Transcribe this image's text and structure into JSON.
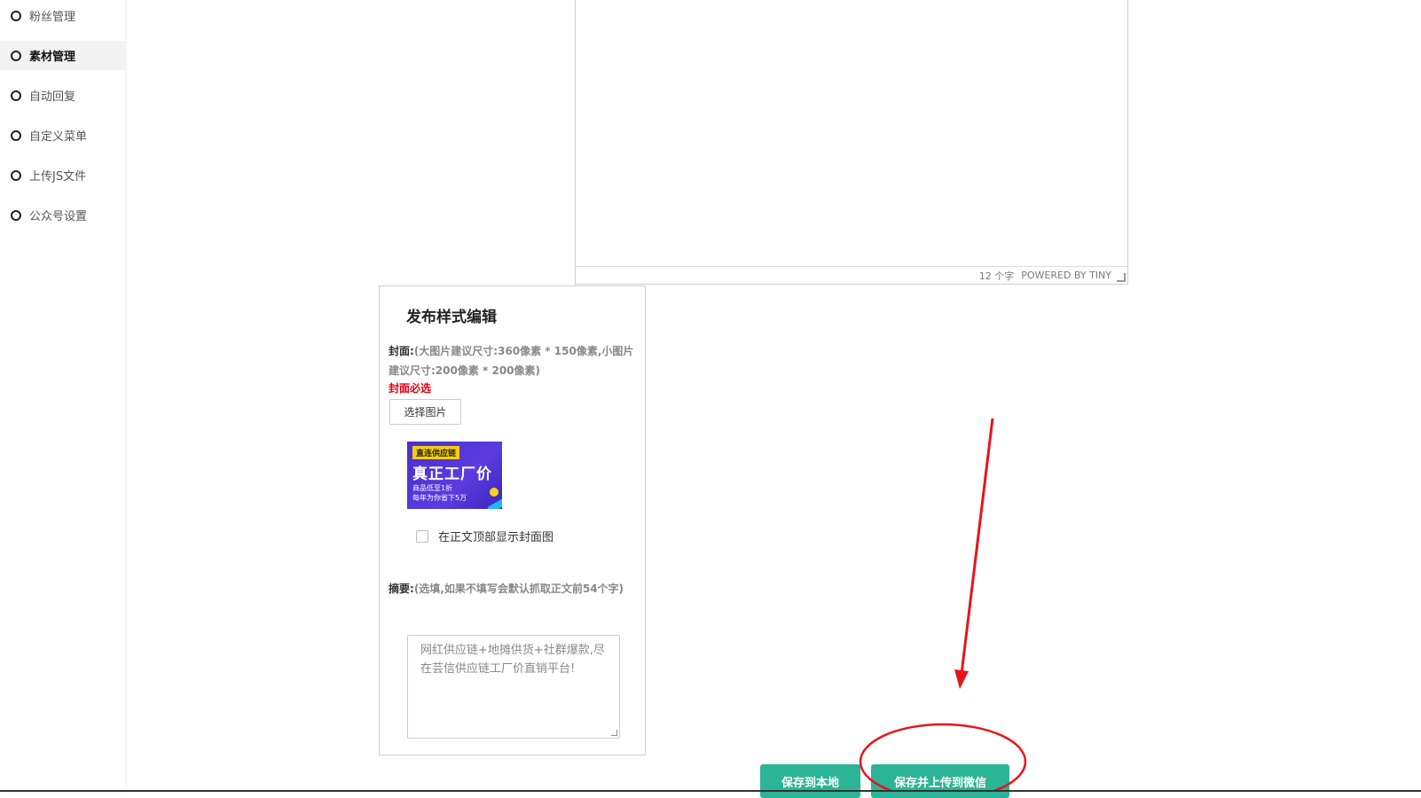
{
  "sidebar": {
    "items": [
      {
        "label": "粉丝管理",
        "active": false
      },
      {
        "label": "素材管理",
        "active": true
      },
      {
        "label": "自动回复",
        "active": false
      },
      {
        "label": "自定义菜单",
        "active": false
      },
      {
        "label": "上传JS文件",
        "active": false
      },
      {
        "label": "公众号设置",
        "active": false
      }
    ]
  },
  "editor": {
    "word_count": "12 个字",
    "powered_by": "POWERED BY TINY"
  },
  "publish_panel": {
    "title": "发布样式编辑",
    "cover_label": "封面:",
    "cover_hint": "(大图片建议尺寸:360像素 * 150像素,小图片建议尺寸:200像素 * 200像素)",
    "cover_required": "封面必选",
    "select_image_button": "选择图片",
    "thumbnail": {
      "tag": "直连供应链",
      "headline": "真正工厂价",
      "line1": "商品低至1折",
      "line2": "每年为你省下5万"
    },
    "show_cover_checkbox": {
      "label": "在正文顶部显示封面图",
      "checked": false
    },
    "summary_label": "摘要:",
    "summary_hint": "(选填,如果不填写会默认抓取正文前54个字)",
    "summary_value": "网红供应链+地摊供货+社群爆款,尽在芸信供应链工厂价直销平台!"
  },
  "actions": {
    "save_local": "保存到本地",
    "save_upload": "保存并上传到微信"
  },
  "colors": {
    "accent_green": "#2bb495",
    "required_red": "#e60012",
    "annotation_red": "#e8141b"
  }
}
